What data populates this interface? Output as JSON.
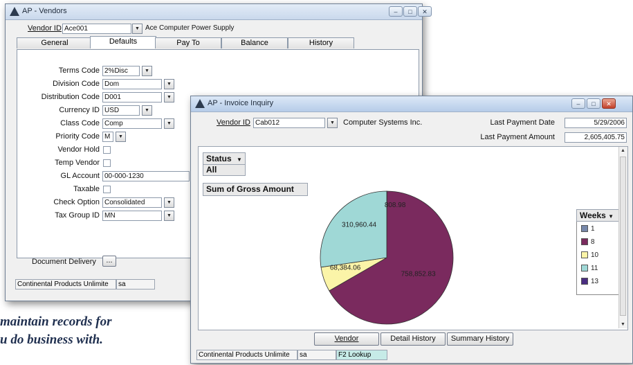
{
  "caption": {
    "line1": "maintain records for",
    "line2": "u do business with."
  },
  "vendors_window": {
    "title": "AP - Vendors",
    "controls": {
      "minimize": "–",
      "maximize": "□",
      "close": "✕"
    },
    "vendor_id_label": "Vendor ID",
    "vendor_id_value": "Ace001",
    "vendor_name": "Ace Computer Power Supply",
    "tabs": [
      "General",
      "Defaults",
      "Pay To",
      "Balance",
      "History"
    ],
    "selected_tab": "Defaults",
    "fields": {
      "terms_code": {
        "label": "Terms Code",
        "value": "2%Disc"
      },
      "division_code": {
        "label": "Division Code",
        "value": "Dom"
      },
      "distribution_code": {
        "label": "Distribution Code",
        "value": "D001"
      },
      "currency_id": {
        "label": "Currency ID",
        "value": "USD"
      },
      "class_code": {
        "label": "Class Code",
        "value": "Comp"
      },
      "priority_code": {
        "label": "Priority Code",
        "value": "M"
      },
      "vendor_hold": {
        "label": "Vendor Hold",
        "checked": false
      },
      "temp_vendor": {
        "label": "Temp Vendor",
        "checked": false
      },
      "gl_account": {
        "label": "GL Account",
        "value": "00-000-1230"
      },
      "taxable": {
        "label": "Taxable",
        "checked": false
      },
      "check_option": {
        "label": "Check Option",
        "value": "Consolidated"
      },
      "tax_group_id": {
        "label": "Tax Group ID",
        "value": "MN"
      }
    },
    "document_delivery_label": "Document Delivery",
    "document_delivery_button": "...",
    "status": {
      "company": "Continental Products Unlimite",
      "user": "sa"
    }
  },
  "invoice_window": {
    "title": "AP - Invoice Inquiry",
    "controls": {
      "minimize": "–",
      "maximize": "□",
      "close": "✕"
    },
    "vendor_id_label": "Vendor ID",
    "vendor_id_value": "Cab012",
    "vendor_name": "Computer Systems Inc.",
    "last_payment_date_label": "Last Payment Date",
    "last_payment_date": "5/29/2006",
    "last_payment_amount_label": "Last Payment Amount",
    "last_payment_amount": "2,605,405.75",
    "pivot": {
      "filter_label": "Status",
      "filter_value": "All",
      "data_field": "Sum of Gross Amount",
      "legend_title": "Weeks"
    },
    "buttons": {
      "vendor": "Vendor",
      "detail_history": "Detail History",
      "summary_history": "Summary History"
    },
    "status": {
      "company": "Continental Products Unlimite",
      "user": "sa",
      "hint": "F2 Lookup"
    }
  },
  "chart_data": {
    "type": "pie",
    "title": "",
    "series_name": "Sum of Gross Amount",
    "legend_title": "Weeks",
    "slices": [
      {
        "label": "1",
        "value": 0,
        "color": "#7788aa",
        "data_label": ""
      },
      {
        "label": "8",
        "value": 758852.83,
        "color": "#7a2a5e",
        "data_label": "758,852.83"
      },
      {
        "label": "10",
        "value": 68384.06,
        "color": "#fbf4a8",
        "data_label": "68,384.06"
      },
      {
        "label": "11",
        "value": 310960.44,
        "color": "#9fd8d6",
        "data_label": "310,960.44"
      },
      {
        "label": "13",
        "value": 808.98,
        "color": "#4a2d82",
        "data_label": "808.98"
      }
    ],
    "legend_position": "right"
  }
}
